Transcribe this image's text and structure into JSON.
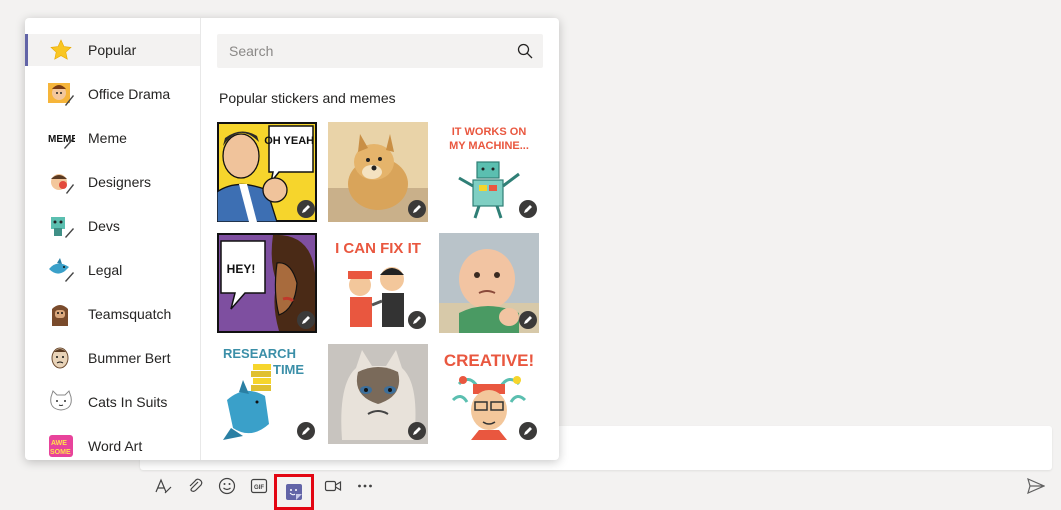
{
  "picker": {
    "search_placeholder": "Search",
    "section_title": "Popular stickers and memes",
    "categories": [
      {
        "label": "Popular",
        "icon": "star-icon",
        "active": true
      },
      {
        "label": "Office Drama",
        "icon": "office-drama-icon"
      },
      {
        "label": "Meme",
        "icon": "meme-icon"
      },
      {
        "label": "Designers",
        "icon": "designers-icon"
      },
      {
        "label": "Devs",
        "icon": "devs-icon"
      },
      {
        "label": "Legal",
        "icon": "legal-shark-icon"
      },
      {
        "label": "Teamsquatch",
        "icon": "teamsquatch-icon"
      },
      {
        "label": "Bummer Bert",
        "icon": "bummer-bert-icon"
      },
      {
        "label": "Cats In Suits",
        "icon": "cats-in-suits-icon"
      },
      {
        "label": "Word Art",
        "icon": "word-art-icon"
      }
    ],
    "stickers": [
      {
        "caption": "OH YEAH!"
      },
      {
        "caption": ""
      },
      {
        "caption": "IT WORKS ON MY MACHINE..."
      },
      {
        "caption": "HEY!"
      },
      {
        "caption": "I CAN FIX IT"
      },
      {
        "caption": ""
      },
      {
        "caption": "RESEARCH TIME"
      },
      {
        "caption": ""
      },
      {
        "caption": "CREATIVE!"
      }
    ]
  },
  "toolbar": {
    "items": [
      "format-icon",
      "attach-icon",
      "emoji-icon",
      "gif-icon",
      "sticker-icon",
      "meet-now-icon",
      "more-options-icon"
    ],
    "gif_label": "GIF"
  },
  "colors": {
    "accent": "#6264a7",
    "highlight": "#e30613"
  }
}
